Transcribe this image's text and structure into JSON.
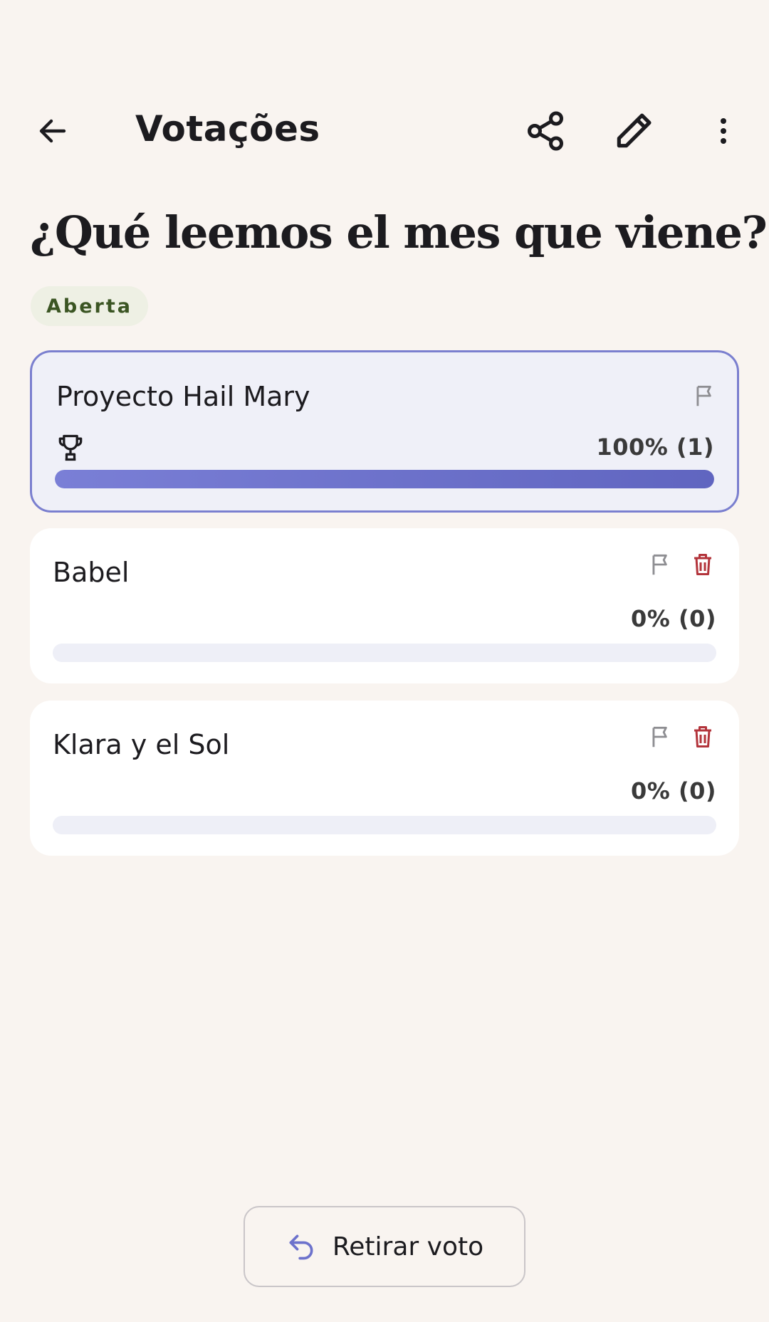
{
  "app_bar": {
    "title": "Votações",
    "back_icon": "arrow-left-icon",
    "share_icon": "share-icon",
    "edit_icon": "pencil-icon",
    "more_icon": "more-vertical-icon"
  },
  "poll": {
    "question": "¿Qué leemos el mes que viene?",
    "status": "Aberta",
    "status_color": "#3b5523",
    "accent_color": "#6d72cc",
    "options": [
      {
        "label": "Proyecto Hail Mary",
        "result": "100% (1)",
        "fraction": 1.0,
        "winner": true
      },
      {
        "label": "Babel",
        "result": "0% (0)",
        "fraction": 0.0,
        "winner": false
      },
      {
        "label": "Klara y el Sol",
        "result": "0% (0)",
        "fraction": 0.0,
        "winner": false
      }
    ]
  },
  "actions": {
    "withdraw_vote": "Retirar voto",
    "withdraw_icon": "undo-arrow-icon"
  }
}
